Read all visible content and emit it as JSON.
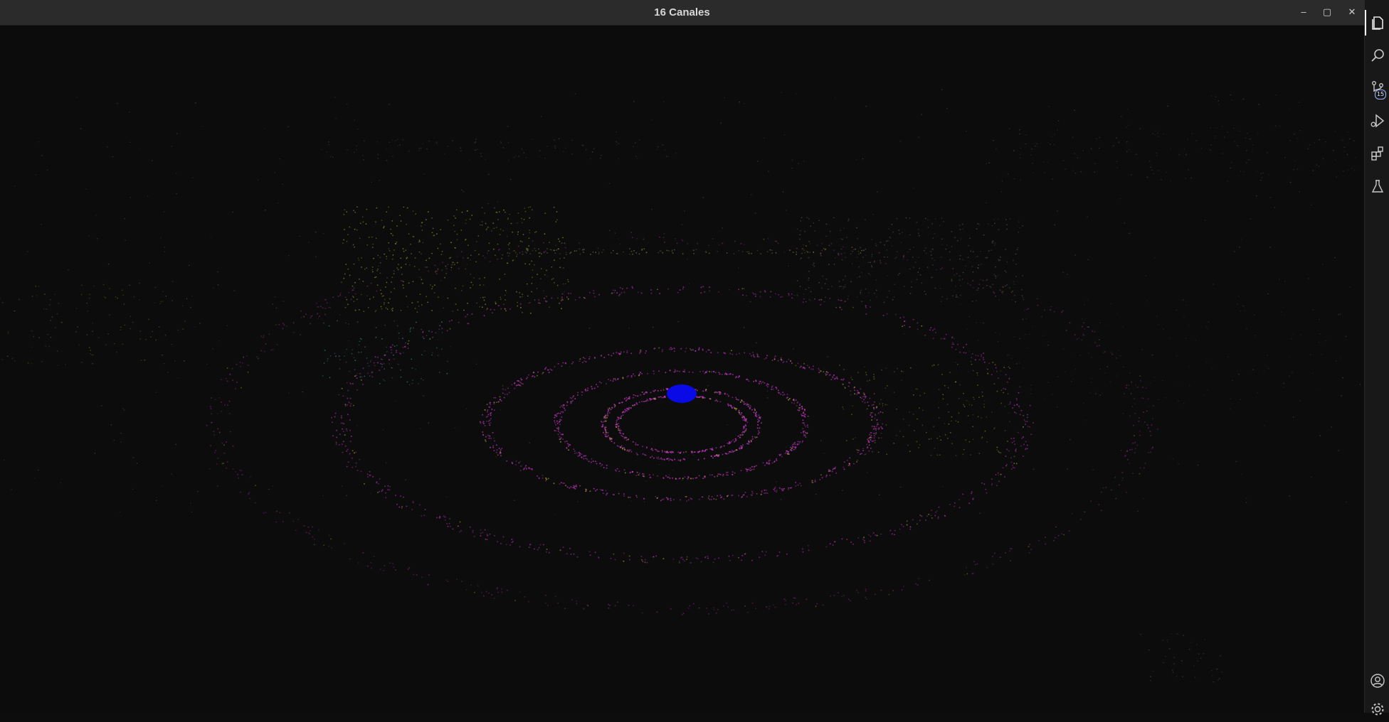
{
  "window": {
    "title": "16 Canales",
    "minimize_glyph": "–",
    "maximize_glyph": "▢",
    "close_glyph": "✕"
  },
  "viewport": {
    "background": "#0c0c0c",
    "sensor_color": "#0a0ae6",
    "ring_color": "#d23cd2",
    "ground_color": "#c8c832",
    "accent_cyan": "#4ec3c3"
  },
  "activity_bar": {
    "items": [
      {
        "name": "explorer",
        "icon": "files-icon"
      },
      {
        "name": "search",
        "icon": "search-icon"
      },
      {
        "name": "source-control",
        "icon": "source-control-icon",
        "badge": "15"
      },
      {
        "name": "run-debug",
        "icon": "run-debug-icon"
      },
      {
        "name": "extensions",
        "icon": "extensions-icon"
      },
      {
        "name": "testing",
        "icon": "flask-icon"
      },
      {
        "name": "accounts",
        "icon": "account-icon"
      },
      {
        "name": "manage",
        "icon": "gear-icon"
      }
    ]
  }
}
